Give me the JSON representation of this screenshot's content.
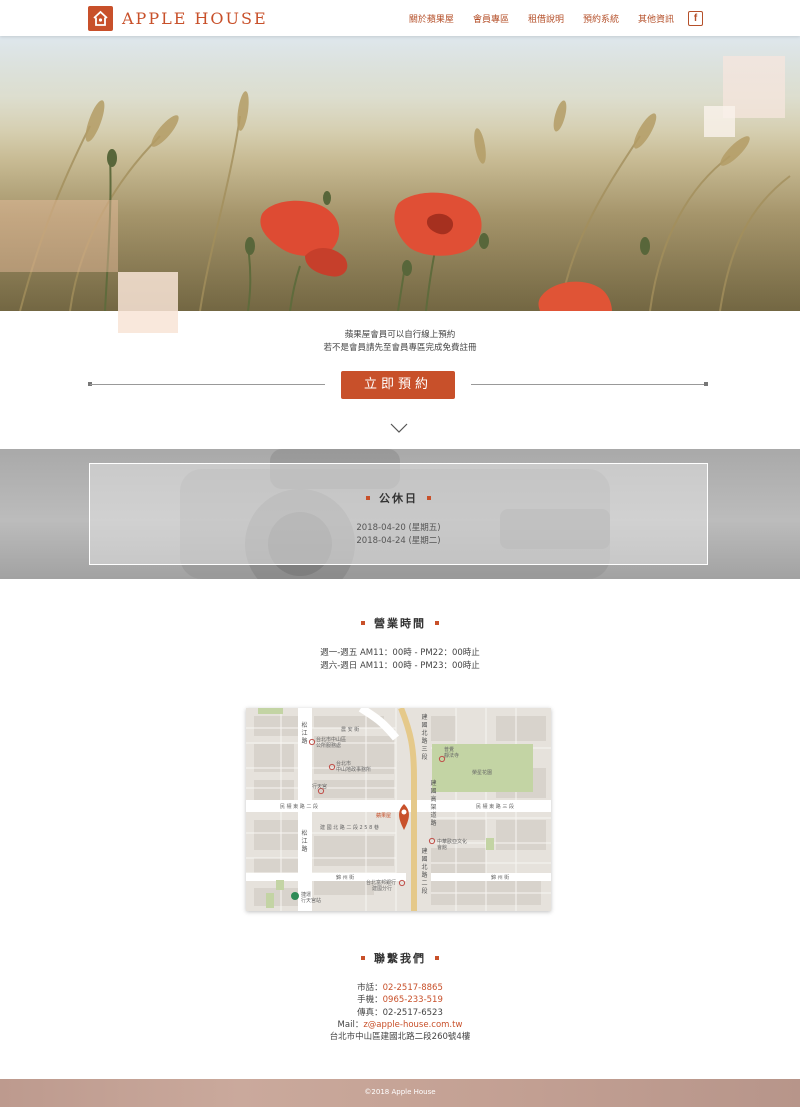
{
  "header": {
    "logo_text": "APPLE HOUSE",
    "nav": [
      "關於蘋果屋",
      "會員專區",
      "租借說明",
      "預約系統",
      "其他資訊"
    ],
    "facebook_glyph": "f"
  },
  "intro": {
    "line1": "蘋果屋會員可以自行線上預約",
    "line2": "若不是會員請先至會員專區完成免費註冊",
    "button": "立即預約"
  },
  "holiday": {
    "title": "公休日",
    "dates": [
      "2018-04-20 (星期五)",
      "2018-04-24 (星期二)"
    ]
  },
  "hours": {
    "title": "營業時間",
    "lines": [
      "週一-週五 AM11：00時 - PM22：00時止",
      "週六-週日 AM11：00時 - PM23：00時止"
    ]
  },
  "map": {
    "labels": {
      "nong_an": "農 安 街",
      "minquan": "民 權 東 路 二 段",
      "minquan3": "民 權 東 路 三 段",
      "jianguo_addr": "建 國 北 路 二 段 2 5 8 巷",
      "jinzhou": "錦 州 街",
      "jinzhou2": "錦 州 街",
      "apple_house": "蘋果屋",
      "park": "榮星花園",
      "office1a": "台北市中山區",
      "office1b": "公所服務處",
      "office2a": "台北市",
      "office2b": "中山地政事務所",
      "xingtian": "行天宮",
      "temple": "普覺",
      "temple2": "靜法寺",
      "cultural_a": "中華歐亞文化",
      "cultural_b": "會館",
      "mrt_a": "捷運",
      "mrt_b": "行天宮站",
      "bank_a": "台北富邦銀行",
      "bank_b": "建國分行",
      "songjiang_top": "松江路",
      "songjiang_bottom": "松江路",
      "jianguo_top": "建國北路三段",
      "jianguo_mid": "建國高架道路",
      "jianguo_bottom": "建國北路二段"
    }
  },
  "contact": {
    "title": "聯繫我們",
    "phone_label": "市話：",
    "phone": "02-2517-8865",
    "mobile_label": "手機：",
    "mobile": "0965-233-519",
    "fax_label": "傳真：",
    "fax": "02-2517-6523",
    "mail_label": "Mail：",
    "mail": "z@apple-house.com.tw",
    "address": "台北市中山區建國北路二段260號4樓"
  },
  "footer": {
    "copyright": "©2018 Apple House"
  },
  "colors": {
    "accent": "#c8502a",
    "map_road_main": "#e5c98a",
    "park_green": "#c3d4a4"
  }
}
